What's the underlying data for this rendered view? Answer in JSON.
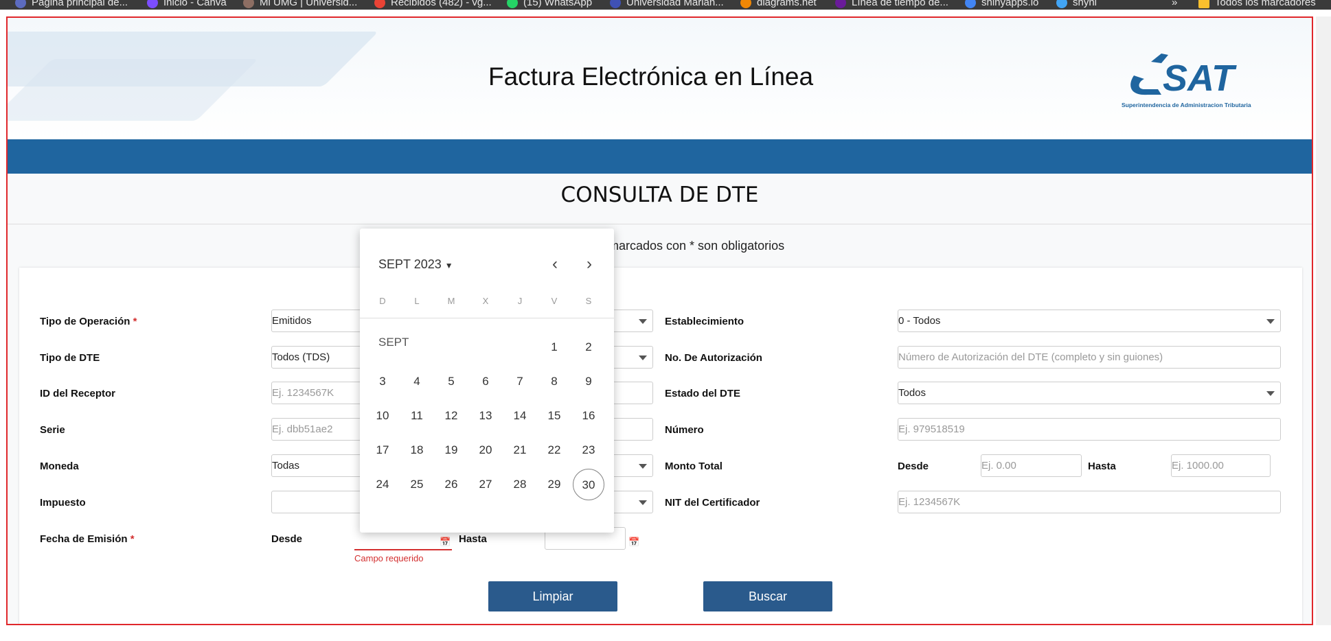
{
  "bookmarks": [
    {
      "label": "Página principal de...",
      "color": "#5c6bc0"
    },
    {
      "label": "Inicio - Canva",
      "color": "#7c4dff"
    },
    {
      "label": "Mi UMG | Universid...",
      "color": "#8d6e63"
    },
    {
      "label": "Recibidos (482) - vg...",
      "color": "#ea4335"
    },
    {
      "label": "(15) WhatsApp",
      "color": "#25d366"
    },
    {
      "label": "Universidad Marian...",
      "color": "#3f51b5"
    },
    {
      "label": "diagrams.net",
      "color": "#f08705"
    },
    {
      "label": "Línea de tiempo de...",
      "color": "#6a1b9a"
    },
    {
      "label": "shinyapps.io",
      "color": "#4285f4"
    },
    {
      "label": "shyni",
      "color": "#42a5f5"
    },
    {
      "label": "»",
      "color": ""
    },
    {
      "label": "Todos los marcadores",
      "color": "#fbc02d"
    }
  ],
  "header": {
    "title": "Factura Electrónica en Línea",
    "logo_text": "SAT",
    "logo_sub": "Superintendencia de Administracion Tributaria"
  },
  "page": {
    "section_title": "CONSULTA DE DTE",
    "note": "marcados con * son obligatorios"
  },
  "form": {
    "tipo_operacion": {
      "label": "Tipo de Operación",
      "value": "Emitidos"
    },
    "tipo_dte": {
      "label": "Tipo de DTE",
      "value": "Todos (TDS)"
    },
    "id_receptor": {
      "label": "ID del Receptor",
      "placeholder": "Ej. 1234567K"
    },
    "serie": {
      "label": "Serie",
      "placeholder": "Ej. dbb51ae2"
    },
    "moneda": {
      "label": "Moneda",
      "value": "Todas"
    },
    "impuesto": {
      "label": "Impuesto",
      "value": ""
    },
    "fecha_emision": {
      "label": "Fecha de Emisión",
      "desde": "Desde",
      "hasta": "Hasta",
      "error": "Campo requerido"
    },
    "establecimiento": {
      "label": "Establecimiento",
      "value": "0 - Todos"
    },
    "no_autorizacion": {
      "label": "No. De Autorización",
      "placeholder": "Número de Autorización del DTE (completo y sin guiones)"
    },
    "estado_dte": {
      "label": "Estado del DTE",
      "value": "Todos"
    },
    "numero": {
      "label": "Número",
      "placeholder": "Ej. 979518519"
    },
    "monto_total": {
      "label": "Monto Total",
      "desde": "Desde",
      "hasta": "Hasta",
      "desde_ph": "Ej. 0.00",
      "hasta_ph": "Ej. 1000.00"
    },
    "nit_certificador": {
      "label": "NIT del Certificador",
      "placeholder": "Ej. 1234567K"
    },
    "required_mark": "*"
  },
  "buttons": {
    "limpiar": "Limpiar",
    "buscar": "Buscar"
  },
  "calendar": {
    "header": "SEPT 2023",
    "month_label": "SEPT",
    "weekdays": [
      "D",
      "L",
      "M",
      "X",
      "J",
      "V",
      "S"
    ],
    "prev": "‹",
    "next": "›",
    "today": "30"
  },
  "colors": {
    "brand_blue": "#1f659f",
    "button": "#2a5a8c",
    "error": "#d32f2f"
  }
}
